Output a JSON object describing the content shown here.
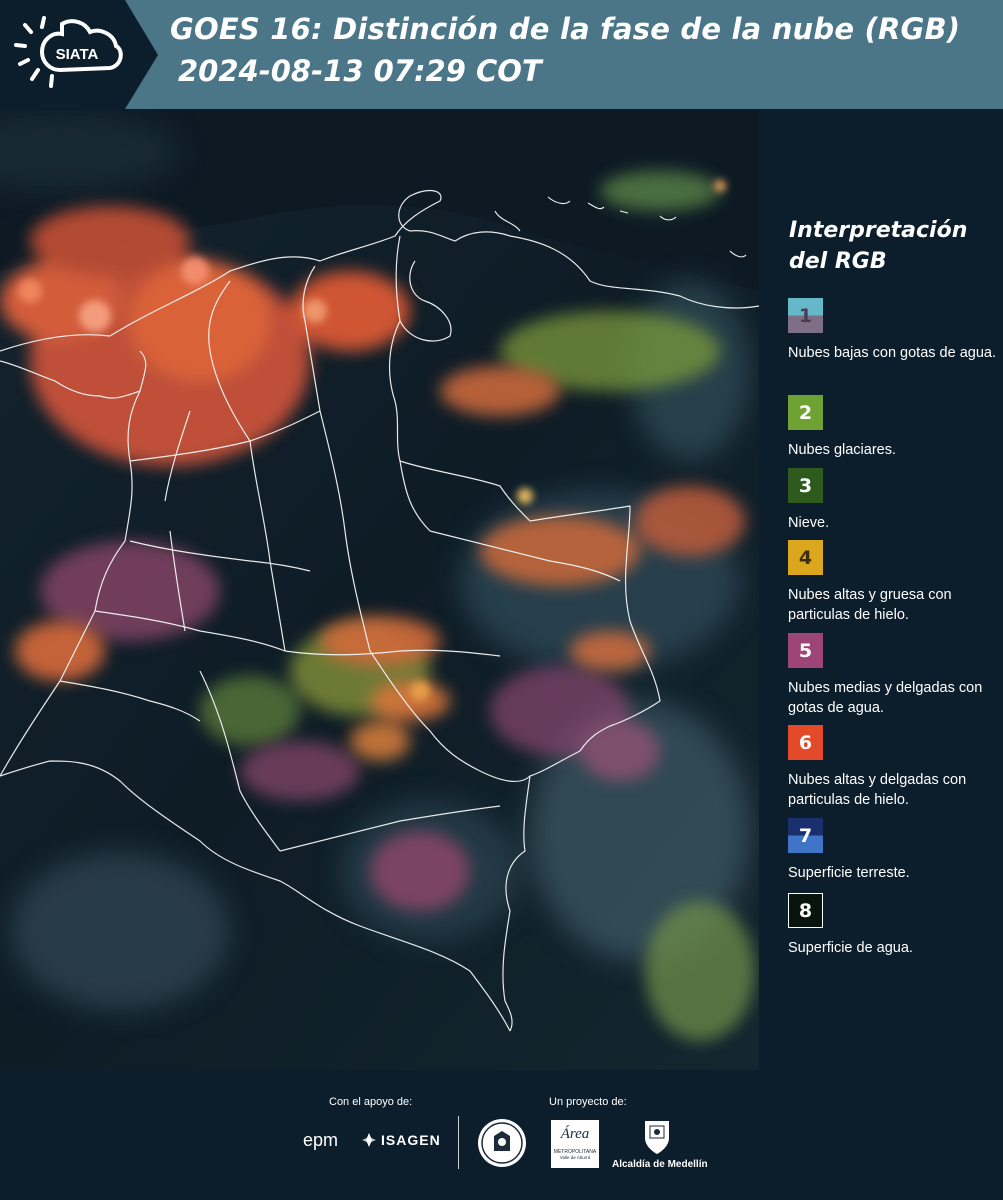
{
  "header": {
    "logo_text": "SIATA",
    "title_line1": "GOES 16: Distinción de la fase de la nube (RGB)",
    "title_line2": "2024-08-13 07:29 COT"
  },
  "legend": {
    "title": "Interpretación del RGB",
    "items": [
      {
        "number": "1",
        "label": "Nubes bajas con gotas de agua.",
        "color_top": "#64b8c8",
        "color_bottom": "#7e6f87",
        "number_color": "#4a3d50"
      },
      {
        "number": "2",
        "label": "Nubes glaciares.",
        "color_top": "#6ea232",
        "color_bottom": "#6ea232",
        "number_color": "#ffffff"
      },
      {
        "number": "3",
        "label": "Nieve.",
        "color_top": "#2e5a1d",
        "color_bottom": "#2e5a1d",
        "number_color": "#ffffff"
      },
      {
        "number": "4",
        "label": "Nubes altas y gruesa con particulas de hielo.",
        "color_top": "#dba71f",
        "color_bottom": "#dba71f",
        "number_color": "#3b2e10"
      },
      {
        "number": "5",
        "label": "Nubes medias y delgadas con gotas de agua.",
        "color_top": "#9d4577",
        "color_bottom": "#9d4577",
        "number_color": "#ffffff"
      },
      {
        "number": "6",
        "label": "Nubes altas y delgadas con particulas de hielo.",
        "color_top": "#e34a2a",
        "color_bottom": "#e34a2a",
        "number_color": "#ffffff"
      },
      {
        "number": "7",
        "label": "Superficie terreste.",
        "color_top": "#1a2f6e",
        "color_bottom": "#3f74c6",
        "number_color": "#ffffff"
      },
      {
        "number": "8",
        "label": "Superficie de agua.",
        "color_top": "#0a140f",
        "color_bottom": "#0a140f",
        "number_color": "#ffffff"
      }
    ]
  },
  "footer": {
    "support_caption": "Con el apoyo de:",
    "project_caption": "Un proyecto de:",
    "epm_text": "epm",
    "isagen_text": "ISAGEN",
    "area_text": "Área",
    "area_subtext": "METROPOLITANA",
    "area_subtext2": "Valle de Aburrá",
    "alcaldia_text": "Alcaldía de Medellín"
  }
}
